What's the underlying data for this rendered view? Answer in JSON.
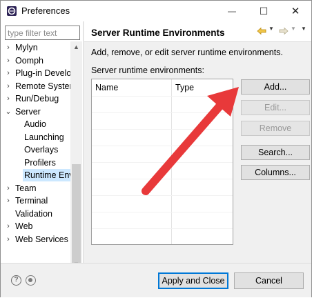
{
  "window": {
    "title": "Preferences",
    "minimize_glyph": "—",
    "maximize_glyph": "☐",
    "close_glyph": "✕"
  },
  "sidebar": {
    "filter_placeholder": "type filter text",
    "items": [
      {
        "label": "Mylyn",
        "expandable": true,
        "expanded": false
      },
      {
        "label": "Oomph",
        "expandable": true,
        "expanded": false
      },
      {
        "label": "Plug-in Develo",
        "expandable": true,
        "expanded": false
      },
      {
        "label": "Remote Systen",
        "expandable": true,
        "expanded": false
      },
      {
        "label": "Run/Debug",
        "expandable": true,
        "expanded": false
      },
      {
        "label": "Server",
        "expandable": true,
        "expanded": true
      },
      {
        "label": "Audio",
        "expandable": false
      },
      {
        "label": "Launching",
        "expandable": false
      },
      {
        "label": "Overlays",
        "expandable": false
      },
      {
        "label": "Profilers",
        "expandable": false
      },
      {
        "label": "Runtime Env",
        "expandable": false,
        "selected": true
      },
      {
        "label": "Team",
        "expandable": true,
        "expanded": false
      },
      {
        "label": "Terminal",
        "expandable": true,
        "expanded": false
      },
      {
        "label": "Validation",
        "expandable": false
      },
      {
        "label": "Web",
        "expandable": true,
        "expanded": false
      },
      {
        "label": "Web Services",
        "expandable": true,
        "expanded": false
      }
    ]
  },
  "main": {
    "title": "Server Runtime Environments",
    "description": "Add, remove, or edit server runtime environments.",
    "list_label": "Server runtime environments:",
    "table": {
      "columns": [
        "Name",
        "Type"
      ],
      "rows": []
    },
    "buttons": {
      "add": "Add...",
      "edit": "Edit...",
      "remove": "Remove",
      "search": "Search...",
      "columns": "Columns..."
    }
  },
  "footer": {
    "apply_close": "Apply and Close",
    "cancel": "Cancel"
  },
  "annotation": {
    "arrow_color": "#e8393a"
  }
}
